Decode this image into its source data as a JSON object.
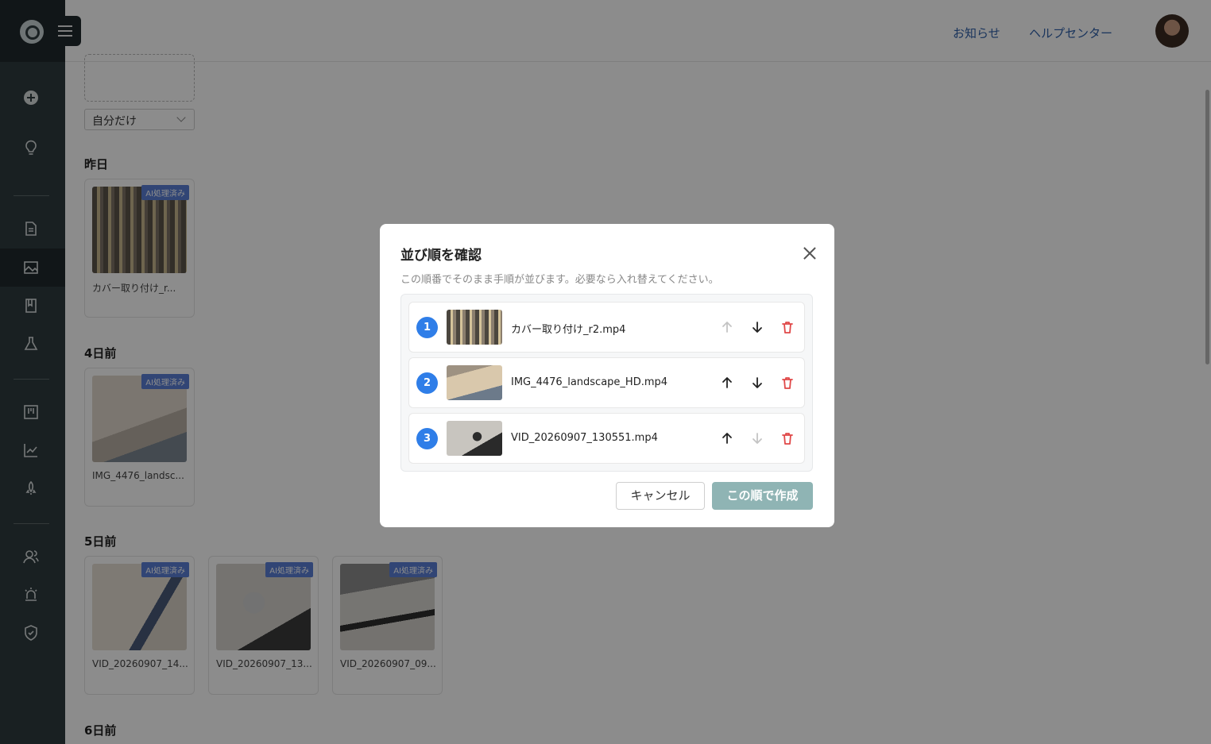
{
  "header": {
    "notice_link": "お知らせ",
    "help_link": "ヘルプセンター"
  },
  "main": {
    "filter_value": "自分だけ",
    "groups": [
      {
        "label": "昨日",
        "items": [
          {
            "name": "カバー取り付け_r...",
            "badge": "AI処理済み"
          }
        ]
      },
      {
        "label": "4日前",
        "items": [
          {
            "name": "IMG_4476_landsc...",
            "badge": "AI処理済み"
          }
        ]
      },
      {
        "label": "5日前",
        "items": [
          {
            "name": "VID_20260907_14...",
            "badge": "AI処理済み"
          },
          {
            "name": "VID_20260907_13...",
            "badge": "AI処理済み"
          },
          {
            "name": "VID_20260907_09...",
            "badge": "AI処理済み"
          }
        ]
      },
      {
        "label": "6日前",
        "items": []
      }
    ]
  },
  "modal": {
    "title": "並び順を確認",
    "description": "この順番でそのまま手順が並びます。必要なら入れ替えてください。",
    "rows": [
      {
        "index": "1",
        "filename": "カバー取り付け_r2.mp4",
        "up_enabled": false,
        "down_enabled": true
      },
      {
        "index": "2",
        "filename": "IMG_4476_landscape_HD.mp4",
        "up_enabled": true,
        "down_enabled": true
      },
      {
        "index": "3",
        "filename": "VID_20260907_130551.mp4",
        "up_enabled": true,
        "down_enabled": false
      }
    ],
    "cancel_label": "キャンセル",
    "create_label": "この順で作成"
  },
  "colors": {
    "accent_blue": "#2f7ee8",
    "sidebar_bg": "#2f3b3f",
    "create_button_disabled": "#8fb4b4",
    "delete_red": "#e04848"
  },
  "icons": [
    "plus-circle-icon",
    "lightbulb-icon",
    "document-icon",
    "image-icon",
    "book-icon",
    "flask-icon",
    "board-icon",
    "chart-icon",
    "rocket-icon",
    "users-icon",
    "alarm-icon",
    "shield-icon",
    "close-icon",
    "arrow-up-icon",
    "arrow-down-icon",
    "trash-icon"
  ]
}
